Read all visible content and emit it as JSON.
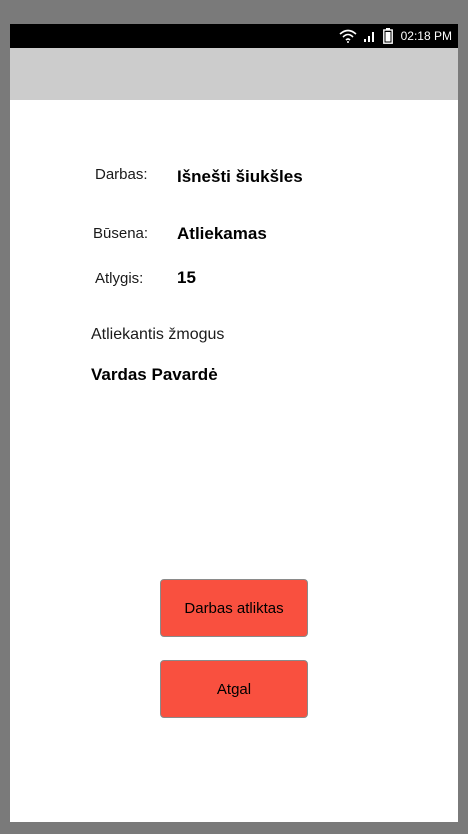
{
  "status_bar": {
    "time": "02:18 PM",
    "icons": [
      "wifi-icon",
      "signal-icon",
      "battery-icon"
    ]
  },
  "task": {
    "work_label": "Darbas:",
    "work_value": "Išnešti šiukšles",
    "status_label": "Būsena:",
    "status_value": "Atliekamas",
    "reward_label": "Atlygis:",
    "reward_value": "15"
  },
  "performer": {
    "label": "Atliekantis žmogus",
    "name": "Vardas Pavardė"
  },
  "buttons": {
    "done_label": "Darbas atliktas",
    "back_label": "Atgal"
  },
  "colors": {
    "button_bg": "#f9503f",
    "app_bar": "#cccccc",
    "status_bar": "#000000"
  }
}
